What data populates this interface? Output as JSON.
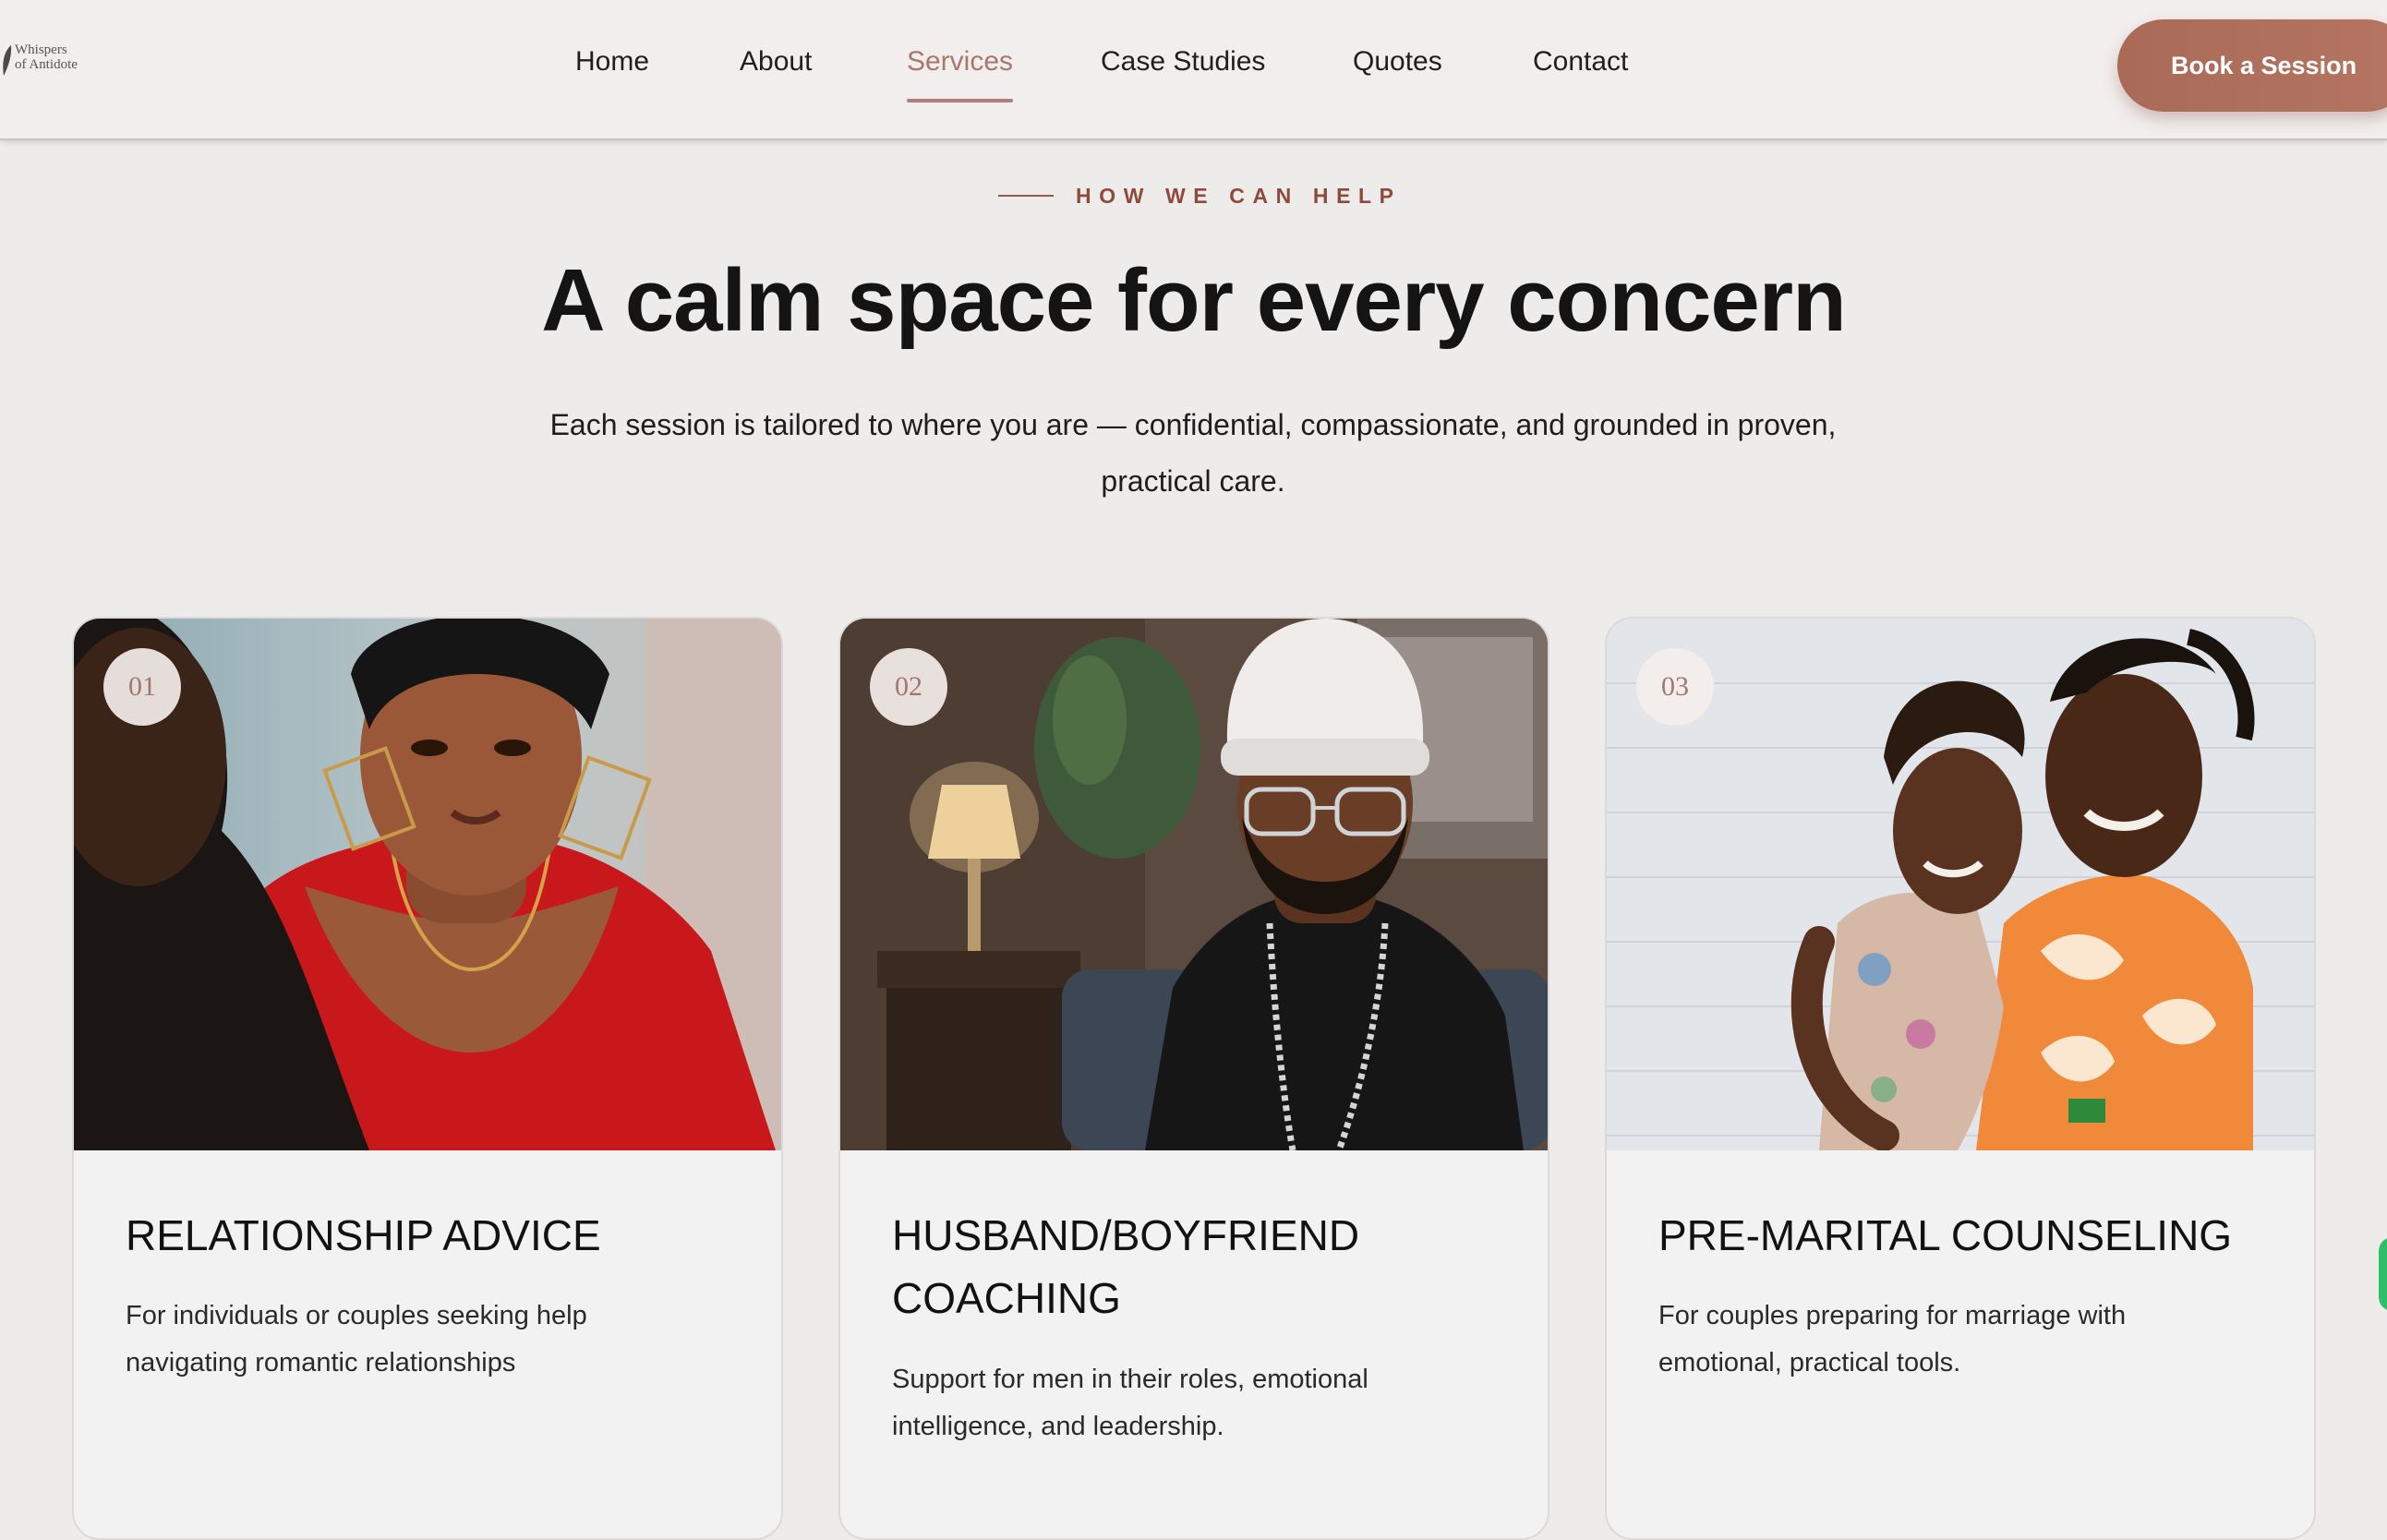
{
  "brand": {
    "logo_text": "Whispers\nof Antidote",
    "accent": "#b07563"
  },
  "nav": {
    "items": [
      {
        "label": "Home",
        "active": false
      },
      {
        "label": "About",
        "active": false
      },
      {
        "label": "Services",
        "active": true
      },
      {
        "label": "Case Studies",
        "active": false
      },
      {
        "label": "Quotes",
        "active": false
      },
      {
        "label": "Contact",
        "active": false
      }
    ],
    "cta_label": "Book a Session"
  },
  "section": {
    "eyebrow": "HOW WE CAN HELP",
    "title": "A calm space for every concern",
    "subtitle": "Each session is tailored to where you are — confidential, compassionate, and grounded in proven, practical care."
  },
  "services": [
    {
      "number": "01",
      "title": "Relationship Advice",
      "description": "For individuals or couples seeking help navigating romantic relationships",
      "photo": "woman-in-red-counseling-session-photo"
    },
    {
      "number": "02",
      "title": "Husband/Boyfriend Coaching",
      "description": "Support for men in their roles, emotional intelligence, and leadership.",
      "photo": "man-in-white-beanie-photo"
    },
    {
      "number": "03",
      "title": "Pre-Marital Counseling",
      "description": "For couples preparing for marriage with emotional, practical tools.",
      "photo": "embracing-couple-photo"
    }
  ]
}
